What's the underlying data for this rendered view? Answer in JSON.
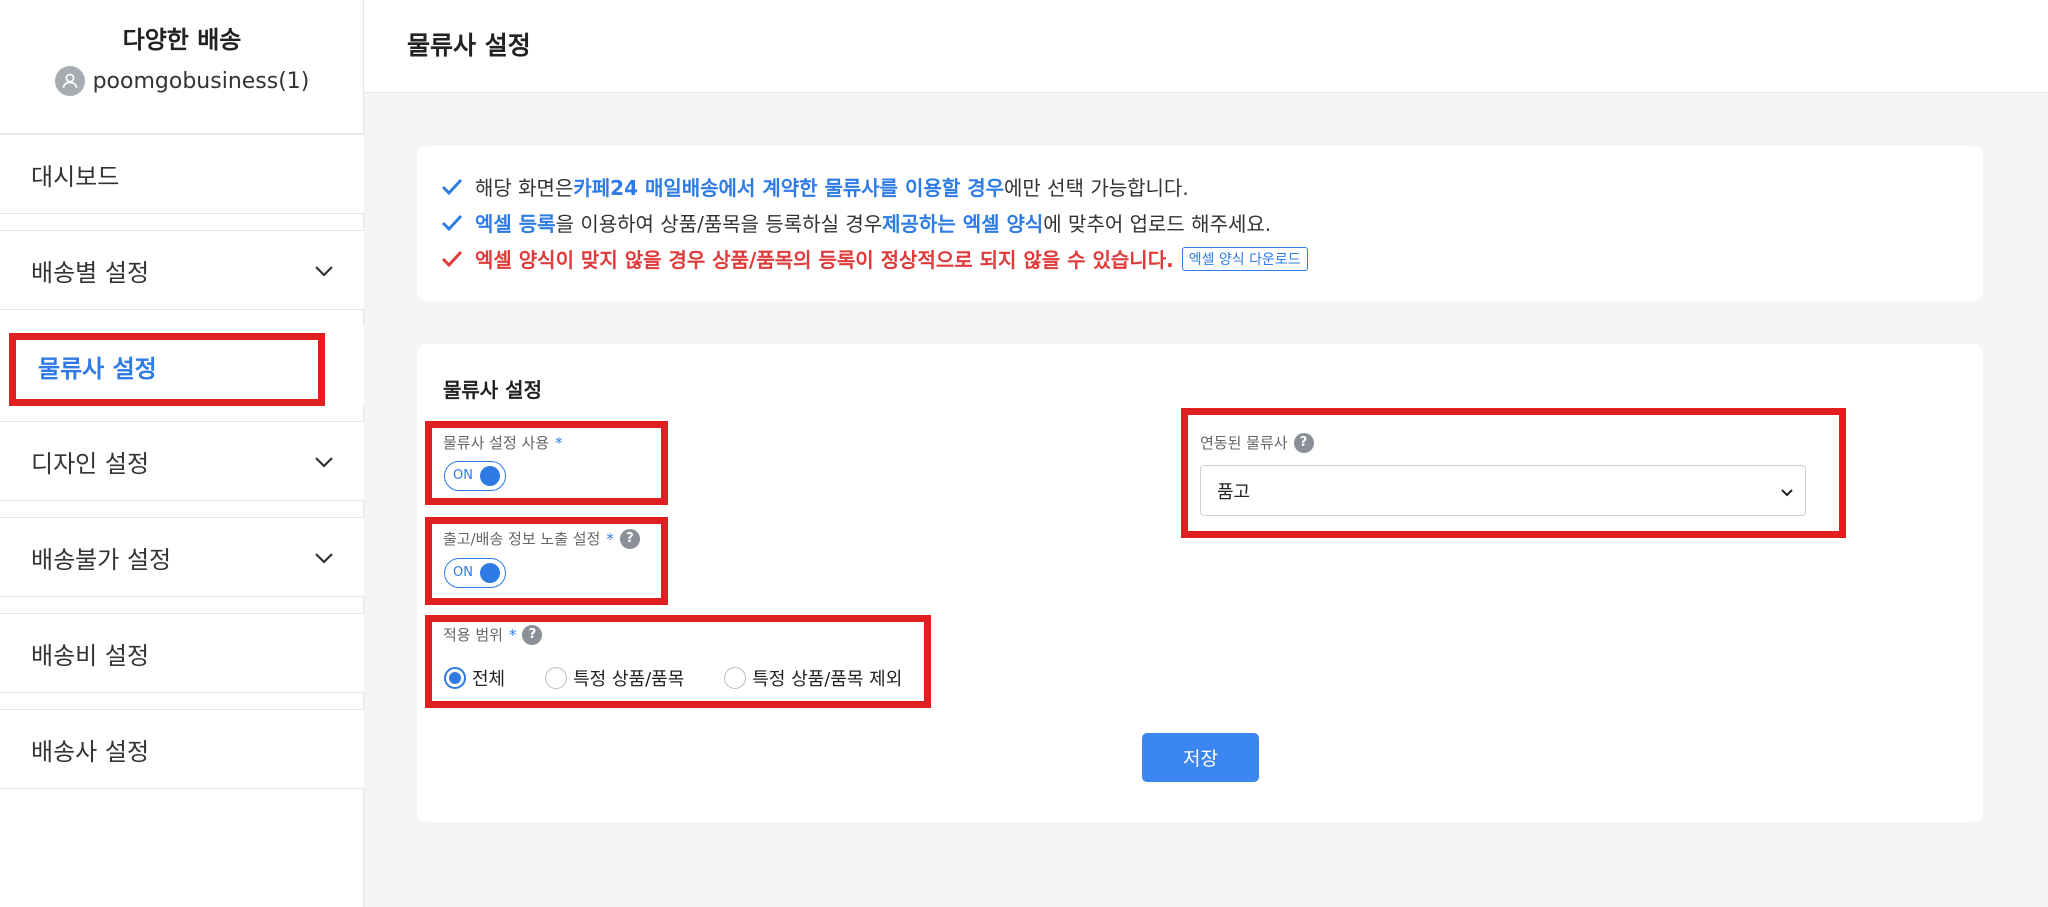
{
  "sidebar": {
    "brand_title": "다양한 배송",
    "user_name": "poomgobusiness(1)",
    "items": [
      {
        "label": "대시보드"
      },
      {
        "label": "배송별 설정"
      },
      {
        "label": "물류사 설정"
      },
      {
        "label": "디자인 설정"
      },
      {
        "label": "배송불가 설정"
      },
      {
        "label": "배송비 설정"
      },
      {
        "label": "배송사 설정"
      }
    ]
  },
  "header": {
    "title": "물류사 설정"
  },
  "notice": {
    "line1": {
      "pre": "해당 화면은 ",
      "b1": "카페24 매일배송에서 계약한 물류사를 이용할 경우",
      "post": "에만 선택 가능합니다."
    },
    "line2": {
      "b1": "엑셀 등록",
      "mid": "을 이용하여 상품/품목을 등록하실 경우 ",
      "b2": "제공하는 엑셀 양식",
      "post": "에 맞추어 업로드 해주세요."
    },
    "line3": {
      "text": "엑셀 양식이 맞지 않을 경우 상품/품목의 등록이 정상적으로 되지 않을 수 있습니다.",
      "button": "엑셀 양식 다운로드"
    }
  },
  "settings": {
    "title": "물류사 설정",
    "use_setting": {
      "label": "물류사 설정 사용",
      "required": "*",
      "toggle": "ON"
    },
    "exposure_setting": {
      "label": "출고/배송 정보 노출 설정",
      "required": "*",
      "toggle": "ON",
      "help": "?"
    },
    "scope": {
      "label": "적용 범위",
      "required": "*",
      "help": "?",
      "options": [
        "전체",
        "특정 상품/품목",
        "특정 상품/품목 제외"
      ],
      "selected": "전체"
    },
    "linked": {
      "label": "연동된 물류사",
      "help": "?",
      "value": "품고"
    },
    "save_label": "저장"
  },
  "colors": {
    "accent": "#2f7be5",
    "highlight": "#e02020",
    "warning": "#e03a3a"
  }
}
